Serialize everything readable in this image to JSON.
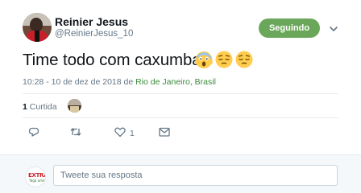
{
  "author": {
    "name": "Reinier Jesus",
    "handle": "@ReinierJesus_10",
    "follow_label": "Seguindo"
  },
  "tweet": {
    "text": "Time todo com caxumba",
    "emojis": [
      "face-screaming-in-fear",
      "pensive-face",
      "pensive-face"
    ],
    "timestamp": "10:28 - 10 de dez de 2018 de ",
    "location": "Rio de Janeiro, Brasil"
  },
  "stats": {
    "likes_count": "1",
    "likes_label": "Curtida"
  },
  "actions": {
    "like_count": "1"
  },
  "reply": {
    "placeholder": "Tweete sua resposta",
    "avatar_text_main": "EXTRA",
    "avatar_text_sub": "Yaga uma"
  },
  "colors": {
    "follow_button": "#6ba75a",
    "location_link": "#3a8a3a",
    "secondary_text": "#657786"
  }
}
